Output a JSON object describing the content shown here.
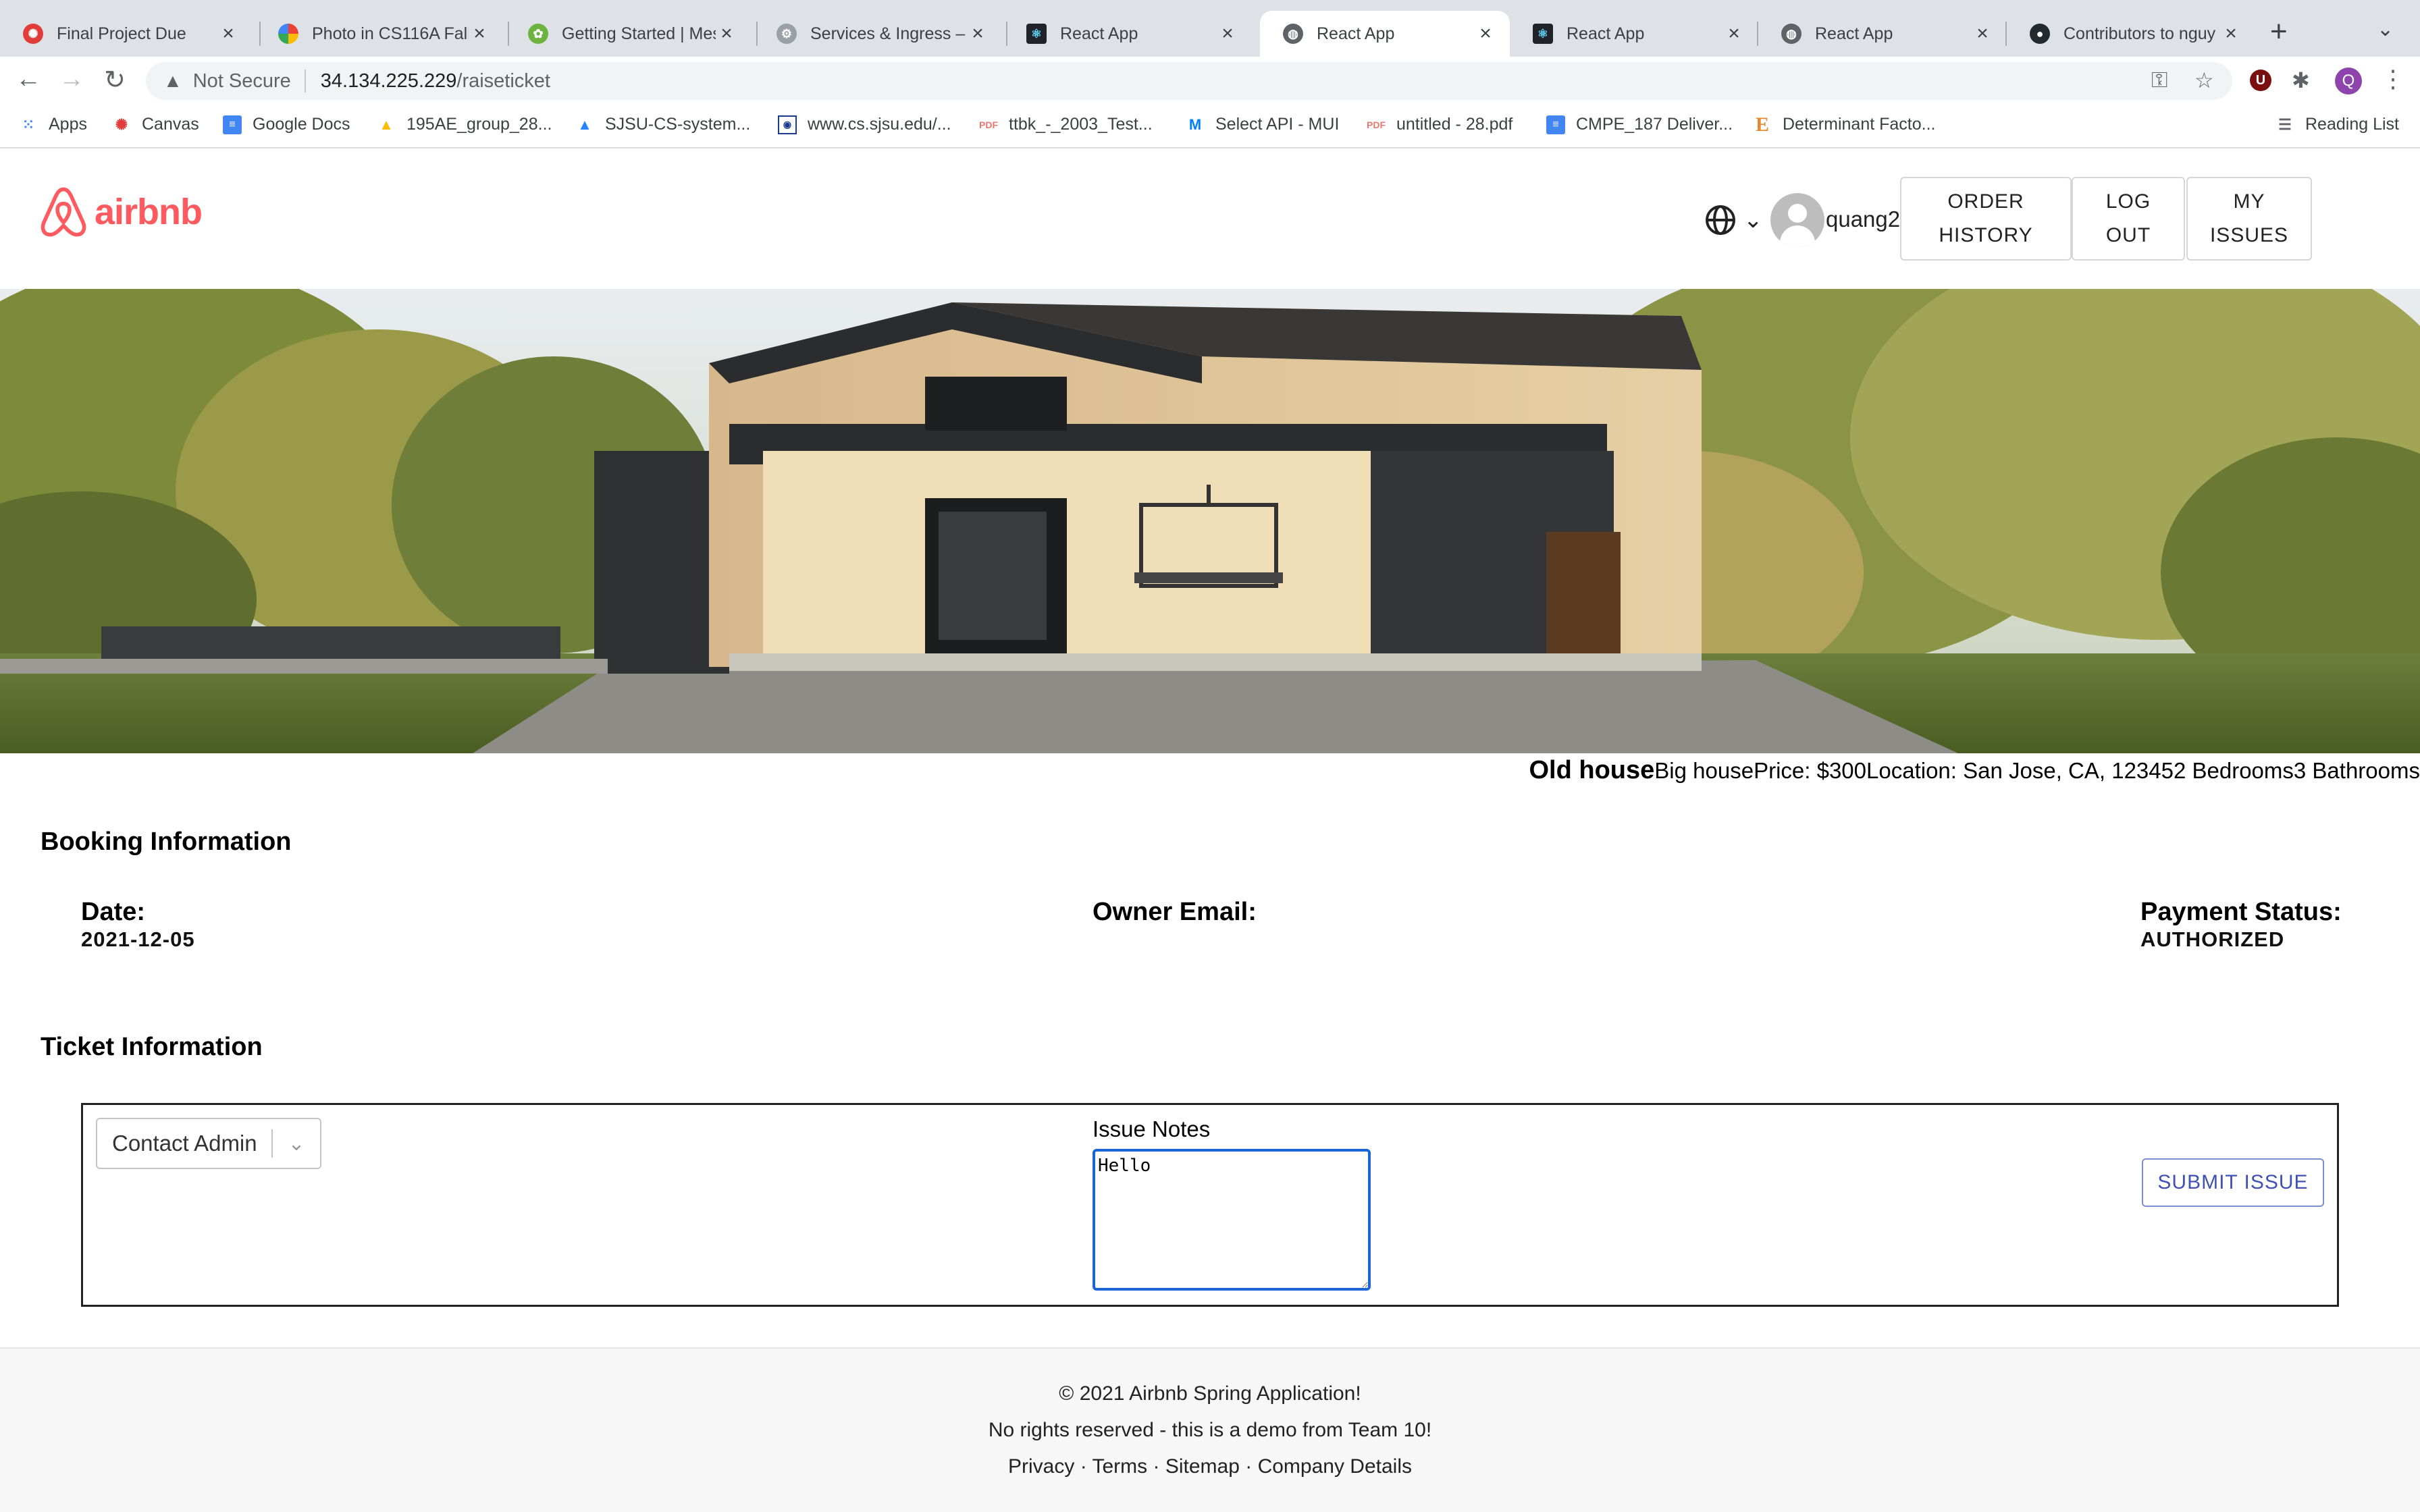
{
  "browser": {
    "tabs": [
      {
        "label": "Final Project Due",
        "icon": "canvas-icon"
      },
      {
        "label": "Photo in CS116A Fall",
        "icon": "google-photos-icon"
      },
      {
        "label": "Getting Started | Mes",
        "icon": "spring-icon"
      },
      {
        "label": "Services & Ingress –",
        "icon": "gke-icon"
      },
      {
        "label": "React App",
        "icon": "react-icon"
      },
      {
        "label": "React App",
        "icon": "globe-icon"
      },
      {
        "label": "React App",
        "icon": "react-icon"
      },
      {
        "label": "React App",
        "icon": "globe-icon"
      },
      {
        "label": "Contributors to nguy",
        "icon": "github-icon"
      }
    ],
    "active_tab_index": 5,
    "address": {
      "security": "Not Secure",
      "host": "34.134.225.229",
      "path": "/raiseticket"
    },
    "profile_initial": "Q",
    "extension_initial": "U",
    "bookmarks": [
      {
        "label": "Apps",
        "icon": "apps-grid-icon"
      },
      {
        "label": "Canvas",
        "icon": "canvas-icon"
      },
      {
        "label": "Google Docs",
        "icon": "google-docs-icon"
      },
      {
        "label": "195AE_group_28...",
        "icon": "google-drive-icon"
      },
      {
        "label": "SJSU-CS-system...",
        "icon": "atlassian-icon"
      },
      {
        "label": "www.cs.sjsu.edu/...",
        "icon": "sjsu-icon"
      },
      {
        "label": "ttbk_-_2003_Test...",
        "icon": "pdf-icon"
      },
      {
        "label": "Select API - MUI",
        "icon": "mui-icon"
      },
      {
        "label": "untitled - 28.pdf",
        "icon": "pdf-icon"
      },
      {
        "label": "CMPE_187 Deliver...",
        "icon": "google-docs-icon"
      },
      {
        "label": "Determinant Facto...",
        "icon": "e-icon"
      }
    ],
    "reading_list": "Reading List"
  },
  "header": {
    "logo_text": "airbnb",
    "username": "quang2",
    "nav": [
      {
        "line1": "ORDER",
        "line2": "HISTORY"
      },
      {
        "line1": "LOG",
        "line2": "OUT"
      },
      {
        "line1": "MY",
        "line2": "ISSUES"
      }
    ]
  },
  "listing": {
    "name": "Old house",
    "details": "Big housePrice: $300Location: San Jose, CA, 123452 Bedrooms3 Bathrooms"
  },
  "booking": {
    "title": "Booking Information",
    "date_label": "Date:",
    "date_value": "2021-12-05",
    "owner_label": "Owner Email:",
    "owner_value": "",
    "payment_label": "Payment Status:",
    "payment_value": "AUTHORIZED"
  },
  "ticket": {
    "title": "Ticket Information",
    "select_value": "Contact Admin",
    "notes_label": "Issue Notes",
    "notes_value": "Hello",
    "submit_label": "SUBMIT ISSUE"
  },
  "footer": {
    "copyright": "© 2021 Airbnb Spring Application!",
    "note": "No rights reserved - this is a demo from Team 10!",
    "links": [
      "Privacy",
      "Terms",
      "Sitemap",
      "Company Details"
    ]
  },
  "colors": {
    "brand": "#FF5A5F",
    "button_text": "#3F51B5",
    "focus": "#1A66D6"
  }
}
